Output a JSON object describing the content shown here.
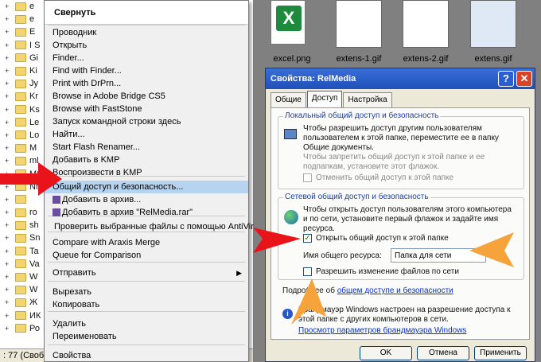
{
  "tree": {
    "items": [
      "e",
      "e",
      "E",
      "I S",
      "Gi",
      "Ki",
      "Jy",
      "Kr",
      "Ks",
      "Le",
      "Lo",
      "M",
      "ml",
      "MS",
      "Nh",
      "",
      "ro",
      "sh",
      "Sn",
      "Ta",
      "Va",
      "W",
      "W",
      "Ж",
      "ИК",
      "Ро"
    ],
    "status": ": 77 (Своб"
  },
  "pane": {
    "thumbnails": [
      {
        "label": "excel.png"
      },
      {
        "label": "extens-1.gif"
      },
      {
        "label": "extens-2.gif"
      },
      {
        "label": "extens.gif"
      }
    ]
  },
  "menu": {
    "title": "Свернуть",
    "items": [
      "Проводник",
      "Открыть",
      "Finder...",
      "Find with Finder...",
      "Print with DrPrn...",
      "Browse in Adobe Bridge CS5",
      "Browse with FastStone",
      "Запуск командной строки здесь",
      "Найти...",
      "Start Flash Renamer...",
      "Добавить в KMP",
      "Воспроизвести в KMP",
      "Общий доступ и безопасность...",
      "Добавить в архив...",
      "Добавить в архив \"RelMedia.rar\"",
      "Проверить выбранные файлы с помощью AntiVir",
      "Compare with Araxis Merge",
      "Queue for Comparison",
      "Отправить",
      "Вырезать",
      "Копировать",
      "Удалить",
      "Переименовать",
      "Свойства"
    ]
  },
  "dialog": {
    "title": "Свойства: RelMedia",
    "help": "?",
    "close": "✕",
    "tabs": [
      "Общие",
      "Доступ",
      "Настройка"
    ],
    "group1_legend": "Локальный общий доступ и безопасность",
    "group1_text1": "Чтобы разрешить доступ другим пользователям пользователем к этой папке, переместите ее в папку Общие документы.",
    "group1_text2": "Чтобы запретить общий доступ к этой папке и ее подпапкам, установите этот флажок.",
    "group1_checkbox": "Отменить общий доступ к этой папке",
    "group2_legend": "Сетевой общий доступ и безопасность",
    "group2_text": "Чтобы открыть доступ пользователям этого компьютера и по сети, установите первый флажок и задайте имя ресурса.",
    "share_checkbox": "Открыть общий доступ к этой папке",
    "share_name_label": "Имя общего ресурса:",
    "share_name_value": "Папка для сети",
    "allow_edit_checkbox": "Разрешить изменение файлов по сети",
    "more_info_prefix": "Подробнее об ",
    "more_info_link": "общем доступе и безопасности",
    "firewall_text": "Брандмауэр Windows настроен на разрешение доступа к этой папке с других компьютеров в сети.",
    "firewall_link": "Просмотр параметров брандмауэра Windows",
    "ok": "OK",
    "cancel": "Отмена",
    "apply": "Применить"
  },
  "colors": {
    "annotation_red": "#e8141a",
    "annotation_orange": "#f5a33a",
    "menu_highlight": "#b6d3f0",
    "title_bar": "#2b5ed0"
  }
}
